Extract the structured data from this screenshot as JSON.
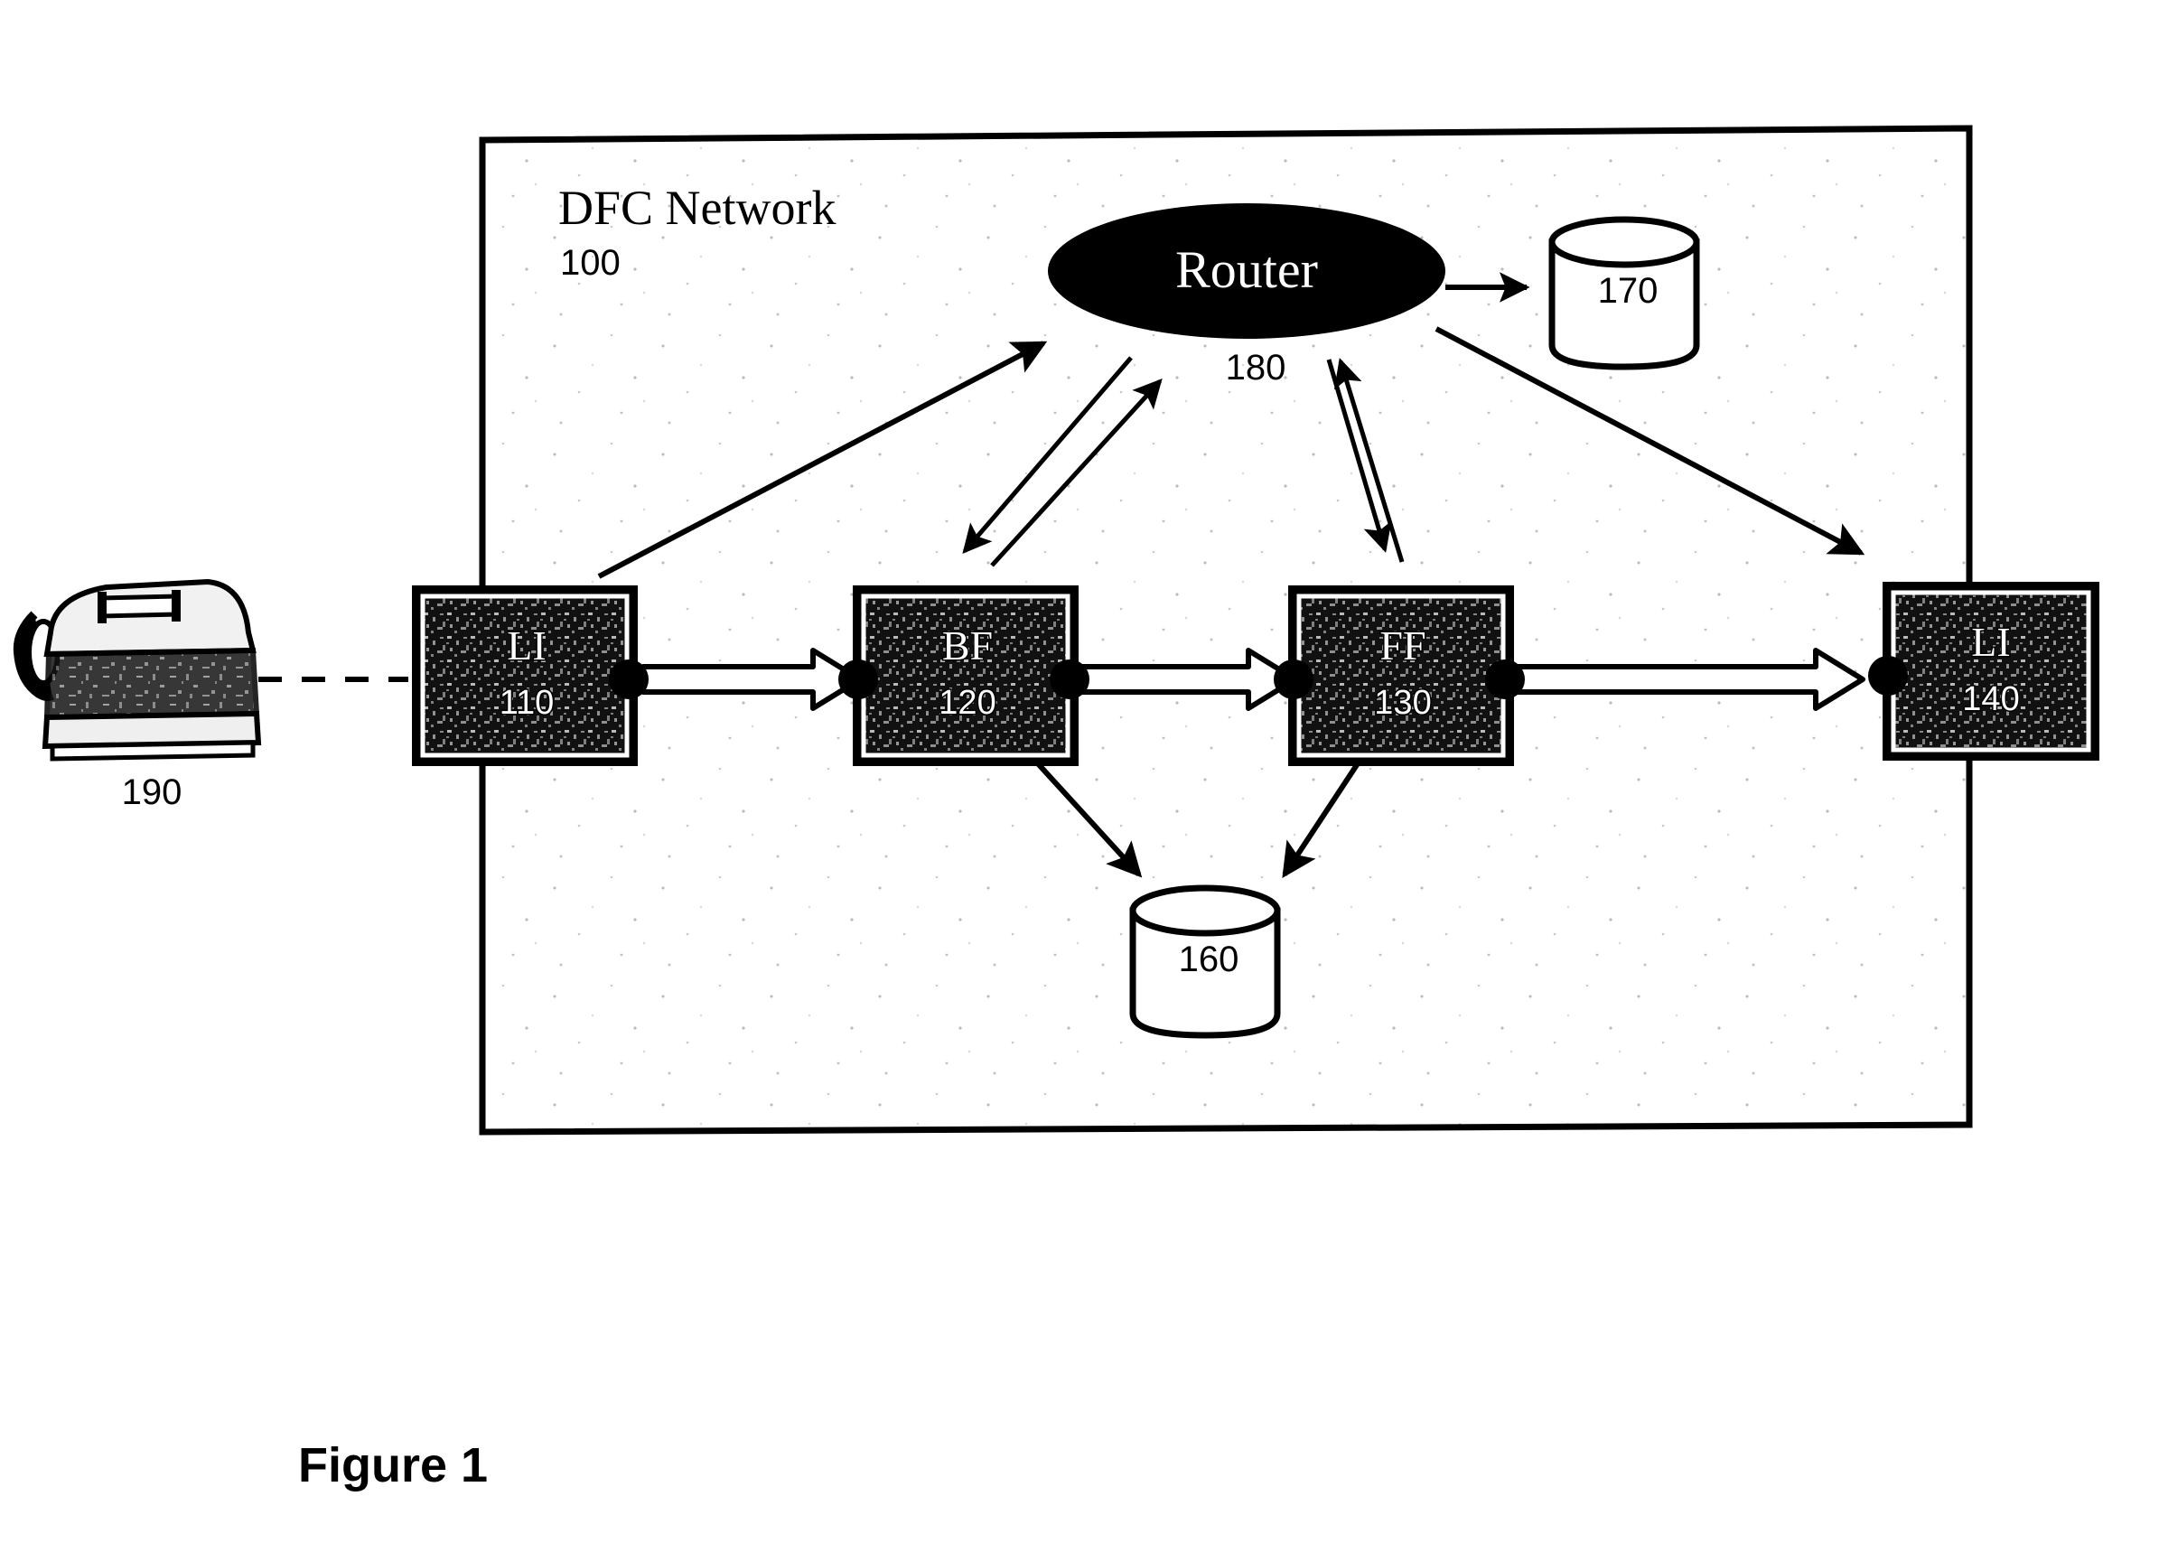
{
  "figure": {
    "caption": "Figure 1",
    "network_title": "DFC Network",
    "network_ref": "100"
  },
  "router": {
    "label": "Router",
    "ref": "180"
  },
  "nodes": [
    {
      "id": "li-110",
      "label": "LI",
      "ref": "110"
    },
    {
      "id": "bf-120",
      "label": "BF",
      "ref": "120"
    },
    {
      "id": "ff-130",
      "label": "FF",
      "ref": "130"
    },
    {
      "id": "li-140",
      "label": "LI",
      "ref": "140"
    }
  ],
  "datastores": [
    {
      "id": "store-170",
      "ref": "170"
    },
    {
      "id": "store-160",
      "ref": "160"
    }
  ],
  "telephone": {
    "ref": "190"
  },
  "colors": {
    "ink": "#000000",
    "paper": "#ffffff",
    "node_fill": "#1a1a1a",
    "router_fill": "#000000"
  }
}
